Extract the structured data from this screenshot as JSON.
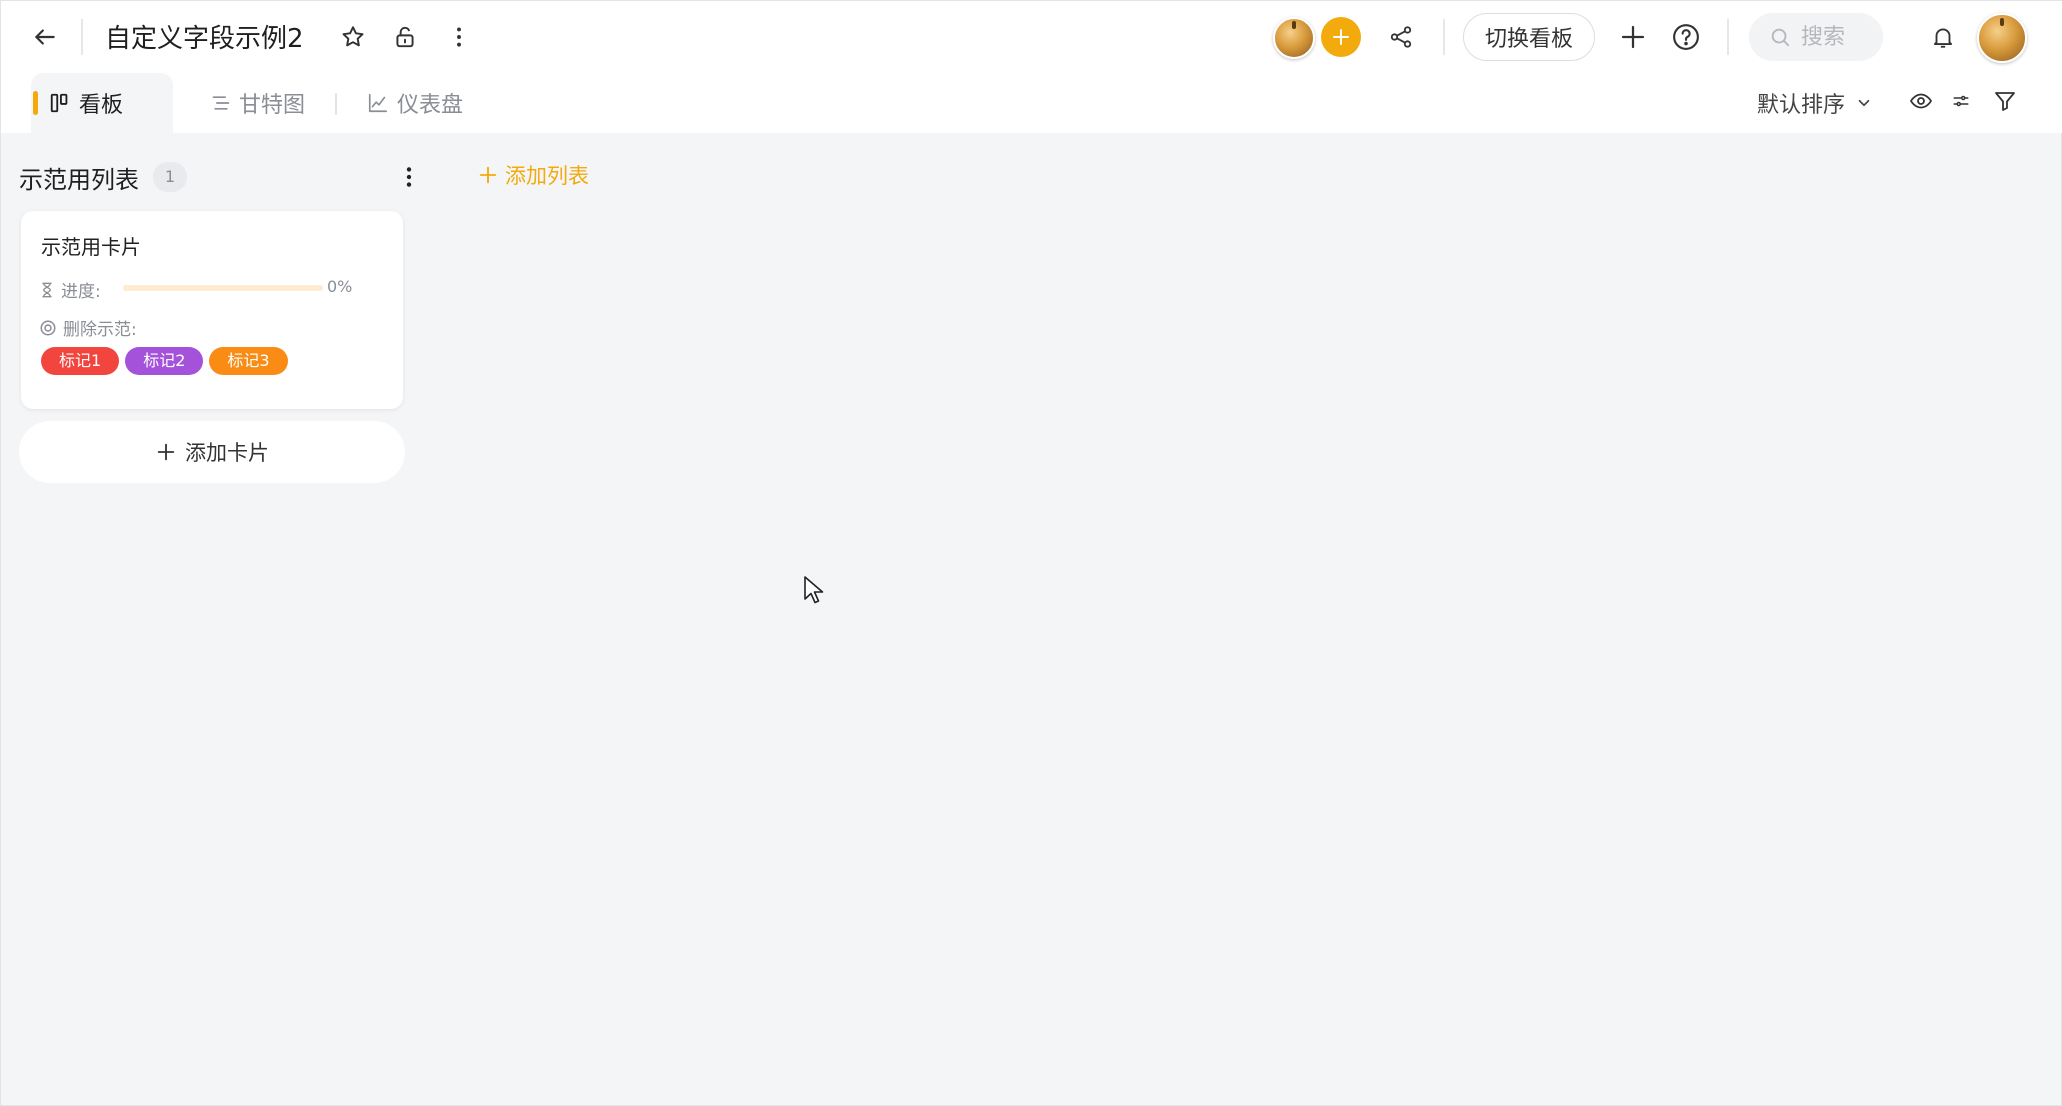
{
  "header": {
    "board_title": "自定义字段示例2",
    "switch_board_label": "切换看板",
    "search_placeholder": "搜索"
  },
  "tabs": [
    {
      "label": "看板",
      "icon": "kanban-icon",
      "active": true
    },
    {
      "label": "甘特图",
      "icon": "gantt-icon",
      "active": false
    },
    {
      "label": "仪表盘",
      "icon": "chart-line-icon",
      "active": false
    }
  ],
  "toolbar": {
    "sort_label": "默认排序"
  },
  "list": {
    "title": "示范用列表",
    "count": "1",
    "add_list_label": "添加列表",
    "add_card_label": "添加卡片"
  },
  "card": {
    "title": "示范用卡片",
    "progress_label": "进度:",
    "progress_value": 0,
    "progress_text": "0%",
    "delete_label": "删除示范:",
    "tags": [
      {
        "label": "标记1",
        "color": "#f2453d"
      },
      {
        "label": "标记2",
        "color": "#a352d9"
      },
      {
        "label": "标记3",
        "color": "#fa8c16"
      }
    ]
  },
  "colors": {
    "accent": "#f2aa0d",
    "background": "#f4f5f7"
  }
}
